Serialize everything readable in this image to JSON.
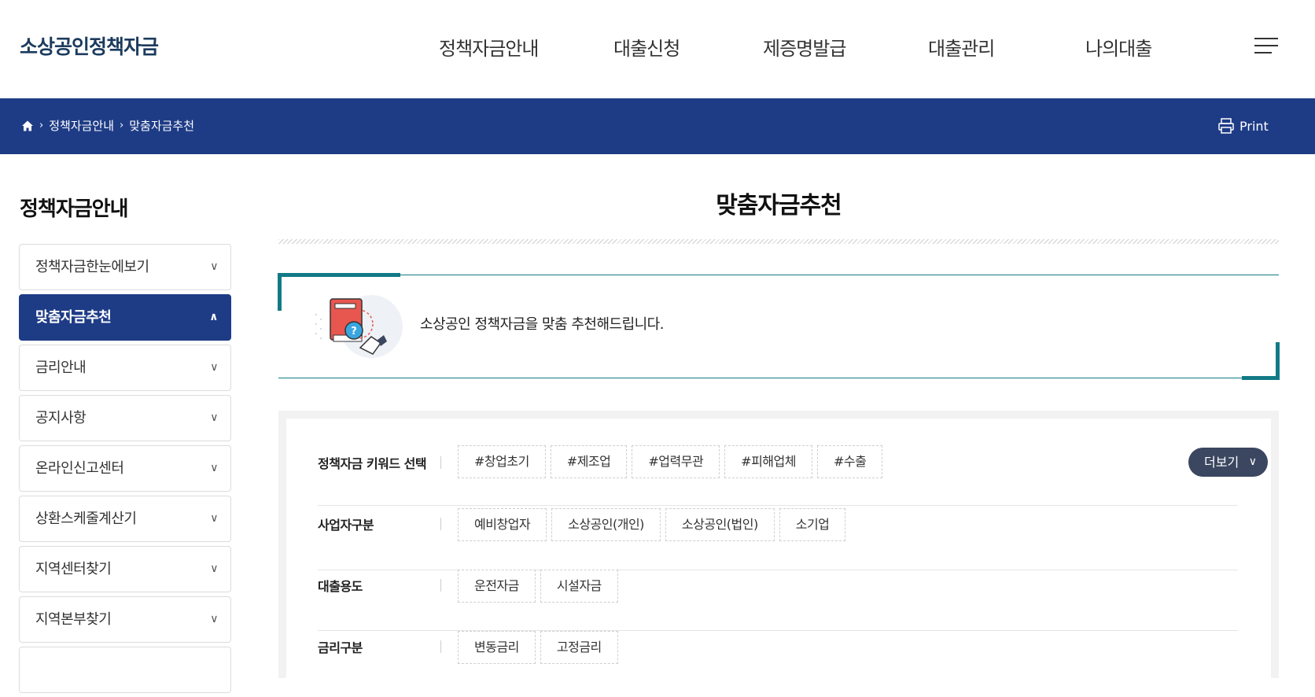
{
  "header": {
    "logo": "소상공인정책자금",
    "nav": [
      "정책자금안내",
      "대출신청",
      "제증명발급",
      "대출관리",
      "나의대출"
    ]
  },
  "breadcrumb": {
    "items": [
      "정책자금안내",
      "맞춤자금추천"
    ],
    "print_label": "Print"
  },
  "sidebar": {
    "title": "정책자금안내",
    "items": [
      {
        "label": "정책자금한눈에보기",
        "icon": "chevron-down-icon"
      },
      {
        "label": "맞춤자금추천",
        "icon": "chevron-up-icon",
        "active": true
      },
      {
        "label": "금리안내",
        "icon": "chevron-down-icon"
      },
      {
        "label": "공지사항",
        "icon": "chevron-down-icon"
      },
      {
        "label": "온라인신고센터",
        "icon": "chevron-down-icon"
      },
      {
        "label": "상환스케줄계산기",
        "icon": "chevron-down-icon"
      },
      {
        "label": "지역센터찾기",
        "icon": "chevron-down-icon"
      },
      {
        "label": "지역본부찾기",
        "icon": "chevron-down-icon"
      }
    ]
  },
  "main": {
    "title": "맞춤자금추천",
    "intro_text": "소상공인 정책자금을 맞춤 추천해드립니다.",
    "filters": [
      {
        "label": "정책자금 키워드 선택",
        "chips": [
          "#창업초기",
          "#제조업",
          "#업력무관",
          "#피해업체",
          "#수출"
        ]
      },
      {
        "label": "사업자구분",
        "chips": [
          "예비창업자",
          "소상공인(개인)",
          "소상공인(법인)",
          "소기업"
        ]
      },
      {
        "label": "대출용도",
        "chips": [
          "운전자금",
          "시설자금"
        ]
      },
      {
        "label": "금리구분",
        "chips": [
          "변동금리",
          "고정금리"
        ]
      }
    ],
    "more_label": "더보기"
  },
  "colors": {
    "brand_blue": "#1e3c86",
    "accent_teal": "#127a86",
    "logo_navy": "#1c3b5e"
  }
}
